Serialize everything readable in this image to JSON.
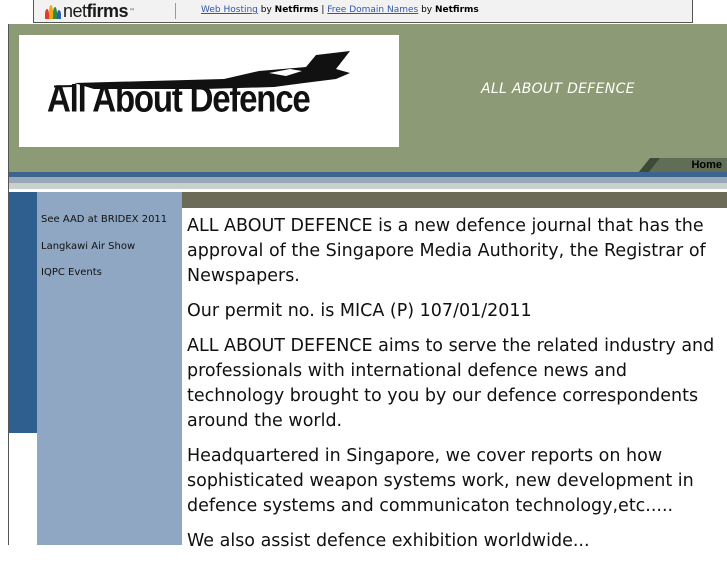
{
  "netfirms_bar": {
    "logo_text_light": "net",
    "logo_text_bold": "firms",
    "logo_tm": "™",
    "link_web_hosting": "Web Hosting",
    "by_1": " by ",
    "netfirms_1": "Netfirms",
    "separator": " | ",
    "link_free_domain": "Free Domain Names",
    "by_2": " by ",
    "netfirms_2": "Netfirms"
  },
  "header": {
    "logo_text": "All About Defence",
    "site_title": "ALL ABOUT DEFENCE",
    "home_tab": "Home"
  },
  "sidebar": {
    "items": [
      {
        "label": "See AAD at BRIDEX 2011"
      },
      {
        "label": "Langkawi Air Show"
      },
      {
        "label": "IQPC Events"
      }
    ]
  },
  "main": {
    "paragraphs": [
      "ALL ABOUT DEFENCE is a new defence journal that has the approval of the Singapore Media Authority, the Registrar of Newspapers.",
      "Our permit no. is MICA (P) 107/01/2011",
      "ALL ABOUT DEFENCE aims to serve the related industry and professionals with  international defence news and technology brought to you by our  defence correspondents around the world.",
      "Headquartered in Singapore, we cover reports on how sophisticated weapon systems work, new development in defence systems and communicaton technology,etc.....",
      "We also assist defence exhibition worldwide..."
    ]
  },
  "colors": {
    "header_bg": "#8c9b75",
    "sidebar_bg": "#8fa7c2",
    "sidebar_dark": "#2f5f8f",
    "link_blue": "#3355aa"
  }
}
